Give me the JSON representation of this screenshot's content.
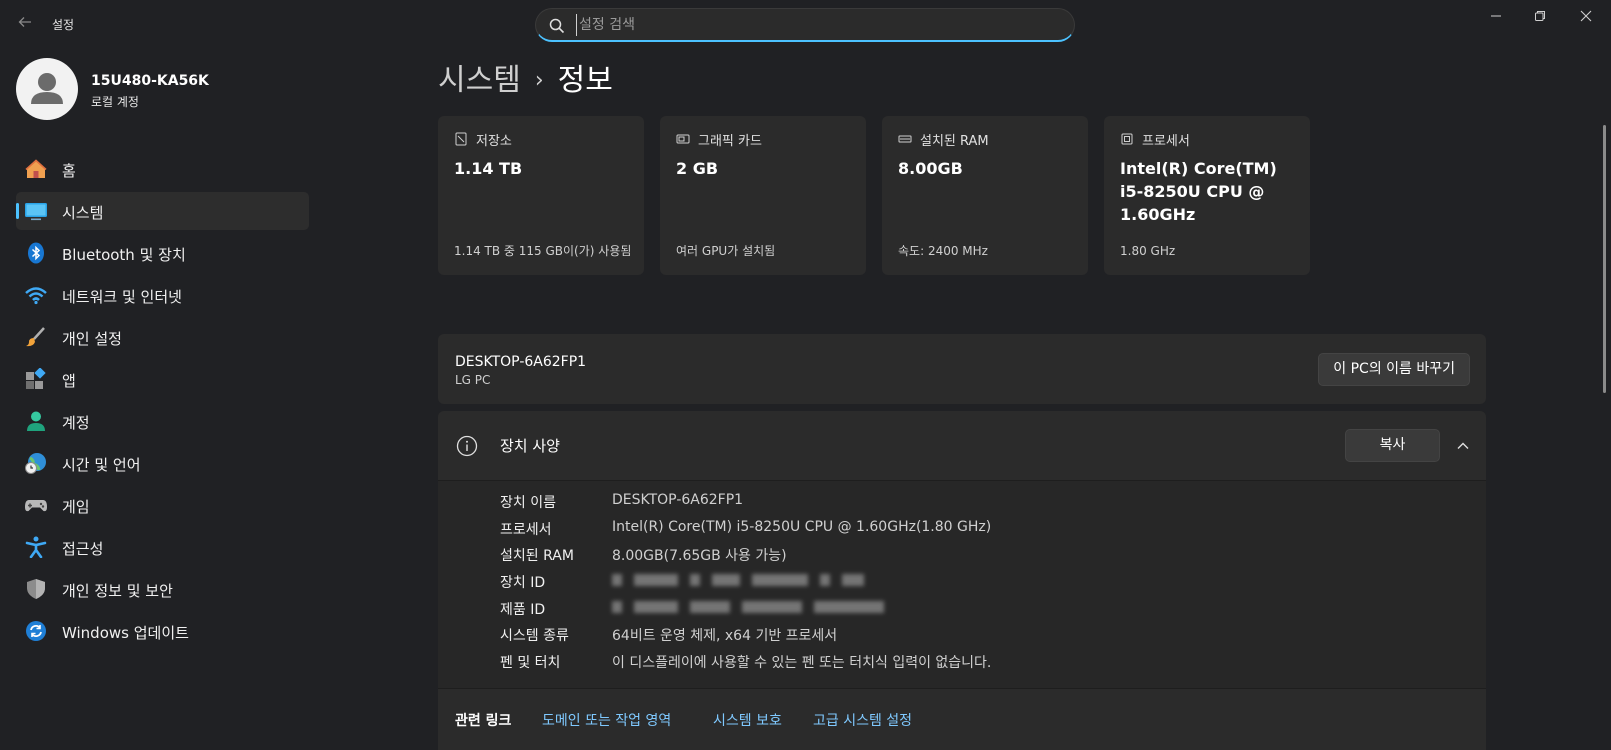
{
  "app": {
    "title": "설정"
  },
  "search": {
    "placeholder": "설정 검색"
  },
  "user": {
    "name": "15U480-KA56K",
    "account_type": "로컬 계정"
  },
  "nav": [
    {
      "label": "홈",
      "icon": "home-icon"
    },
    {
      "label": "시스템",
      "icon": "monitor-icon",
      "active": true
    },
    {
      "label": "Bluetooth 및 장치",
      "icon": "bluetooth-icon"
    },
    {
      "label": "네트워크 및 인터넷",
      "icon": "wifi-icon"
    },
    {
      "label": "개인 설정",
      "icon": "brush-icon"
    },
    {
      "label": "앱",
      "icon": "apps-icon"
    },
    {
      "label": "계정",
      "icon": "person-icon"
    },
    {
      "label": "시간 및 언어",
      "icon": "globe-clock-icon"
    },
    {
      "label": "게임",
      "icon": "gamepad-icon"
    },
    {
      "label": "접근성",
      "icon": "accessibility-icon"
    },
    {
      "label": "개인 정보 및 보안",
      "icon": "shield-icon"
    },
    {
      "label": "Windows 업데이트",
      "icon": "update-icon"
    }
  ],
  "breadcrumb": {
    "parent": "시스템",
    "separator": "›",
    "current": "정보"
  },
  "cards": [
    {
      "label": "저장소",
      "icon": "storage-icon",
      "value": "1.14 TB",
      "sub": "1.14 TB 중 115 GB이(가) 사용됨"
    },
    {
      "label": "그래픽 카드",
      "icon": "gpu-icon",
      "value": "2 GB",
      "sub": "여러 GPU가 설치됨"
    },
    {
      "label": "설치된 RAM",
      "icon": "ram-icon",
      "value": "8.00GB",
      "sub": "속도: 2400 MHz"
    },
    {
      "label": "프로세서",
      "icon": "cpu-icon",
      "value": "Intel(R) Core(TM) i5-8250U CPU @ 1.60GHz",
      "sub": "1.80 GHz"
    }
  ],
  "pc": {
    "name": "DESKTOP-6A62FP1",
    "model": "LG PC",
    "rename_label": "이 PC의 이름 바꾸기"
  },
  "device_specs": {
    "title": "장치 사양",
    "copy_label": "복사",
    "rows": [
      {
        "key": "장치 이름",
        "value": "DESKTOP-6A62FP1"
      },
      {
        "key": "프로세서",
        "value": "Intel(R) Core(TM) i5-8250U CPU @ 1.60GHz(1.80 GHz)"
      },
      {
        "key": "설치된 RAM",
        "value": "8.00GB(7.65GB 사용 가능)"
      },
      {
        "key": "장치 ID",
        "value": ""
      },
      {
        "key": "제품 ID",
        "value": ""
      },
      {
        "key": "시스템 종류",
        "value": "64비트 운영 체제, x64 기반 프로세서"
      },
      {
        "key": "펜 및 터치",
        "value": "이 디스플레이에 사용할 수 있는 펜 또는 터치식 입력이 없습니다."
      }
    ]
  },
  "related_links": {
    "label": "관련 링크",
    "links": [
      "도메인 또는 작업 영역",
      "시스템 보호",
      "고급 시스템 설정"
    ]
  },
  "colors": {
    "accent": "#4cc2ff",
    "background": "#202124",
    "card": "#2b2b2b",
    "link": "#7fc9ff"
  }
}
